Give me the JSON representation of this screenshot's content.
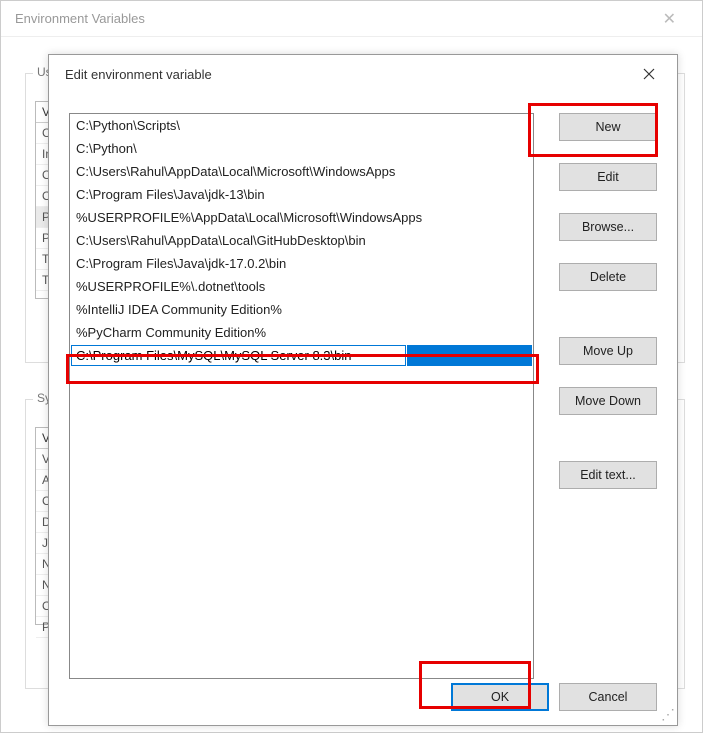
{
  "bgWindow": {
    "title": "Environment Variables",
    "userLabel": "User",
    "systemLabel": "Syste",
    "headerVar": "Va",
    "userRows": [
      "CA",
      "In",
      "Or",
      "Or",
      "Pa",
      "Py",
      "TE",
      "TN"
    ],
    "systemRows": [
      "Va",
      "AV",
      "Co",
      "Dr",
      "JA",
      "NI",
      "NU",
      "OS",
      "P"
    ]
  },
  "dialog": {
    "title": "Edit environment variable",
    "paths": [
      "C:\\Python\\Scripts\\",
      "C:\\Python\\",
      "C:\\Users\\Rahul\\AppData\\Local\\Microsoft\\WindowsApps",
      "C:\\Program Files\\Java\\jdk-13\\bin",
      "%USERPROFILE%\\AppData\\Local\\Microsoft\\WindowsApps",
      "C:\\Users\\Rahul\\AppData\\Local\\GitHubDesktop\\bin",
      "C:\\Program Files\\Java\\jdk-17.0.2\\bin",
      "%USERPROFILE%\\.dotnet\\tools",
      "%IntelliJ IDEA Community Edition%",
      "%PyCharm Community Edition%"
    ],
    "editingValue": "C:\\Program Files\\MySQL\\MySQL Server 8.3\\bin",
    "buttons": {
      "new": "New",
      "edit": "Edit",
      "browse": "Browse...",
      "delete": "Delete",
      "moveUp": "Move Up",
      "moveDown": "Move Down",
      "editText": "Edit text...",
      "ok": "OK",
      "cancel": "Cancel"
    }
  }
}
